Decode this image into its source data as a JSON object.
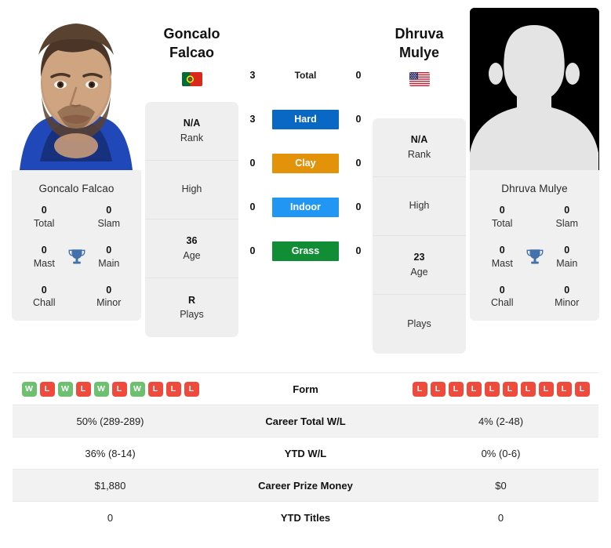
{
  "players": {
    "left": {
      "name_line1": "Goncalo",
      "name_line2": "Falcao",
      "full_name": "Goncalo Falcao",
      "flag": "portugal-flag",
      "photo": "player-photo",
      "info": [
        {
          "value": "N/A",
          "label": "Rank"
        },
        {
          "value": "",
          "label": "High"
        },
        {
          "value": "36",
          "label": "Age"
        },
        {
          "value": "R",
          "label": "Plays"
        }
      ],
      "titles": [
        {
          "value": "0",
          "label": "Total"
        },
        {
          "value": "0",
          "label": "Slam"
        },
        {
          "value": "0",
          "label": "Mast"
        },
        {
          "value": "0",
          "label": "Main"
        },
        {
          "value": "0",
          "label": "Chall"
        },
        {
          "value": "0",
          "label": "Minor"
        }
      ],
      "form": [
        "W",
        "L",
        "W",
        "L",
        "W",
        "L",
        "W",
        "L",
        "L",
        "L"
      ],
      "career_total_wl": "50% (289-289)",
      "ytd_wl": "36% (8-14)",
      "career_prize_money": "$1,880",
      "ytd_titles": "0"
    },
    "right": {
      "name_line1": "Dhruva",
      "name_line2": "Mulye",
      "full_name": "Dhruva Mulye",
      "flag": "usa-flag",
      "photo": "player-photo-placeholder",
      "info": [
        {
          "value": "N/A",
          "label": "Rank"
        },
        {
          "value": "",
          "label": "High"
        },
        {
          "value": "23",
          "label": "Age"
        },
        {
          "value": "",
          "label": "Plays"
        }
      ],
      "titles": [
        {
          "value": "0",
          "label": "Total"
        },
        {
          "value": "0",
          "label": "Slam"
        },
        {
          "value": "0",
          "label": "Mast"
        },
        {
          "value": "0",
          "label": "Main"
        },
        {
          "value": "0",
          "label": "Chall"
        },
        {
          "value": "0",
          "label": "Minor"
        }
      ],
      "form": [
        "L",
        "L",
        "L",
        "L",
        "L",
        "L",
        "L",
        "L",
        "L",
        "L"
      ],
      "career_total_wl": "4% (2-48)",
      "ytd_wl": "0% (0-6)",
      "career_prize_money": "$0",
      "ytd_titles": "0"
    }
  },
  "head_to_head": [
    {
      "label": "Total",
      "left": "3",
      "right": "0",
      "style": "plain",
      "color": ""
    },
    {
      "label": "Hard",
      "left": "3",
      "right": "0",
      "style": "badge",
      "color": "#0868c4"
    },
    {
      "label": "Clay",
      "left": "0",
      "right": "0",
      "style": "badge",
      "color": "#e3930a"
    },
    {
      "label": "Indoor",
      "left": "0",
      "right": "0",
      "style": "badge",
      "color": "#2196f3"
    },
    {
      "label": "Grass",
      "left": "0",
      "right": "0",
      "style": "badge",
      "color": "#118d36"
    }
  ],
  "table_rows": [
    {
      "label": "Form",
      "type": "form",
      "shade": "plain"
    },
    {
      "label": "Career Total W/L",
      "type": "text",
      "shade": "alt",
      "key": "career_total_wl"
    },
    {
      "label": "YTD W/L",
      "type": "text",
      "shade": "plain",
      "key": "ytd_wl"
    },
    {
      "label": "Career Prize Money",
      "type": "text",
      "shade": "alt",
      "key": "career_prize_money"
    },
    {
      "label": "YTD Titles",
      "type": "text",
      "shade": "plain",
      "key": "ytd_titles"
    }
  ],
  "icons": {
    "trophy": "trophy-icon"
  }
}
